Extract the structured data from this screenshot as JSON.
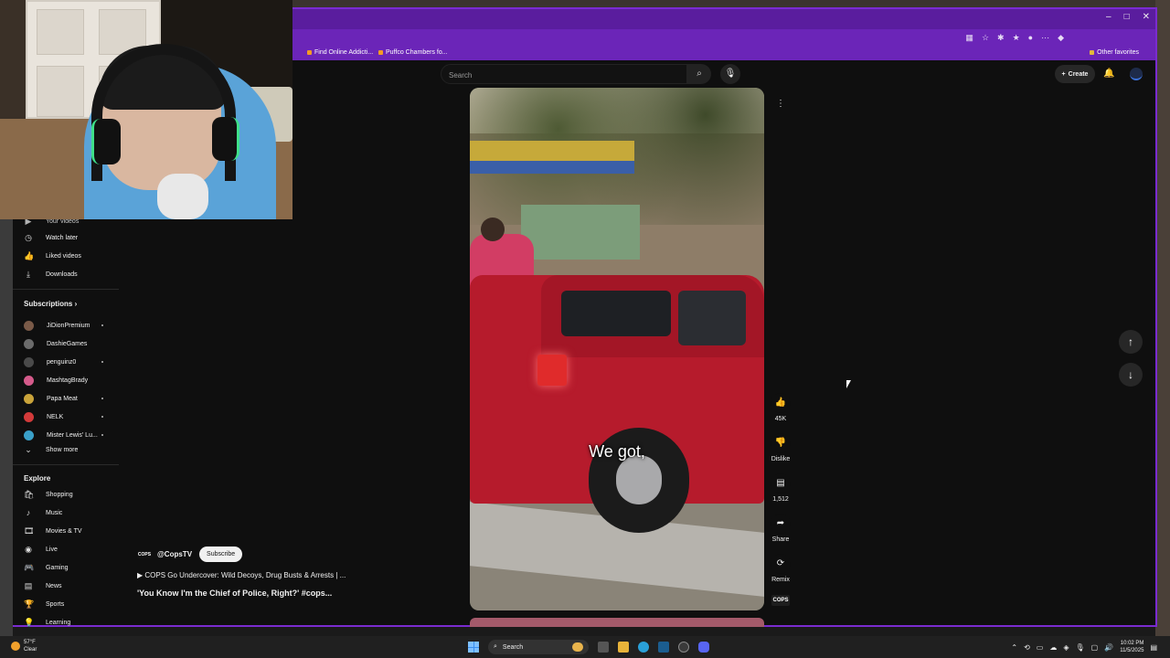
{
  "window": {
    "minimize": "–",
    "maximize": "□",
    "close": "✕"
  },
  "bookmarks": [
    {
      "label": "Find Online Addicti..."
    },
    {
      "label": "Puffco Chambers fo..."
    }
  ],
  "bookmarks_other": "Other favorites",
  "header": {
    "search_placeholder": "Search",
    "create_label": "Create"
  },
  "sidebar": {
    "you_items": [
      {
        "label": "Your videos",
        "icon": "play-square-icon"
      },
      {
        "label": "Watch later",
        "icon": "clock-icon"
      },
      {
        "label": "Liked videos",
        "icon": "thumbs-up-icon"
      },
      {
        "label": "Downloads",
        "icon": "download-icon"
      }
    ],
    "subscriptions_title": "Subscriptions",
    "subscriptions": [
      {
        "label": "JiDionPremium",
        "color": "#7a5a48",
        "new": true
      },
      {
        "label": "DashieGames",
        "color": "#6b6b6b",
        "new": false
      },
      {
        "label": "penguinz0",
        "color": "#4a4a4a",
        "new": true
      },
      {
        "label": "MashtagBrady",
        "color": "#d45a8a",
        "new": false
      },
      {
        "label": "Papa Meat",
        "color": "#c9a33a",
        "new": true
      },
      {
        "label": "NELK",
        "color": "#d33a3a",
        "new": true
      },
      {
        "label": "Mister Lewis' Lu...",
        "color": "#3aa0c9",
        "new": true
      }
    ],
    "show_more": "Show more",
    "explore_title": "Explore",
    "explore": [
      {
        "label": "Shopping",
        "icon": "shopping-bag-icon"
      },
      {
        "label": "Music",
        "icon": "music-note-icon"
      },
      {
        "label": "Movies & TV",
        "icon": "film-icon"
      },
      {
        "label": "Live",
        "icon": "live-icon"
      },
      {
        "label": "Gaming",
        "icon": "gamepad-icon"
      },
      {
        "label": "News",
        "icon": "news-icon"
      },
      {
        "label": "Sports",
        "icon": "trophy-icon"
      },
      {
        "label": "Learning",
        "icon": "bulb-icon"
      }
    ]
  },
  "video": {
    "caption": "We got,"
  },
  "actions": {
    "likes": "45K",
    "dislike": "Dislike",
    "comments": "1,512",
    "share": "Share",
    "remix": "Remix"
  },
  "channel": {
    "logo_text": "COPS",
    "handle": "@CopsTV",
    "subscribe": "Subscribe",
    "playlist": "COPS Go Undercover: Wild Decoys, Drug Busts & Arrests | ...",
    "title": "'You Know I'm the Chief of Police, Right?' #cops..."
  },
  "taskbar": {
    "temp": "57°F",
    "condition": "Clear",
    "search": "Search",
    "time": "10:02 PM",
    "date": "11/5/2025"
  }
}
